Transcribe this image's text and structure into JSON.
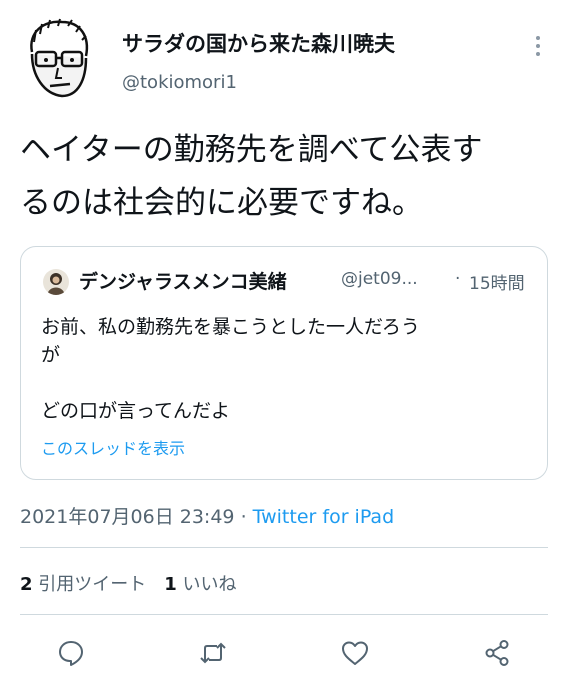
{
  "author": {
    "display_name": "サラダの国から来た森川暁夫",
    "handle": "@tokiomori1"
  },
  "tweet": {
    "text_line1": "ヘイターの勤務先を調べて公表す",
    "text_line2": "るのは社会的に必要ですね。"
  },
  "quoted_tweet": {
    "display_name": "デンジャラスメンコ美緒",
    "handle": "@jet09...",
    "separator": "·",
    "time_ago": "15時間",
    "body_line1": "お前、私の勤務先を暴こうとした一人だろう",
    "body_line2": "が",
    "body_line3": "",
    "body_line4": "どの口が言ってんだよ",
    "show_thread_link": "このスレッドを表示"
  },
  "meta": {
    "timestamp": "2021年07月06日 23:49",
    "separator": "·",
    "source": "Twitter for iPad"
  },
  "stats": {
    "retweets_count": "2",
    "retweets_label": "引用ツイート",
    "likes_count": "1",
    "likes_label": "いいね"
  },
  "colors": {
    "accent": "#1d9bf0",
    "secondary_text": "#536471",
    "border": "#cfd9de"
  },
  "icons": {
    "more": "more-vertical-icon",
    "reply": "reply-icon",
    "retweet": "retweet-icon",
    "like": "heart-icon",
    "share": "share-icon"
  }
}
